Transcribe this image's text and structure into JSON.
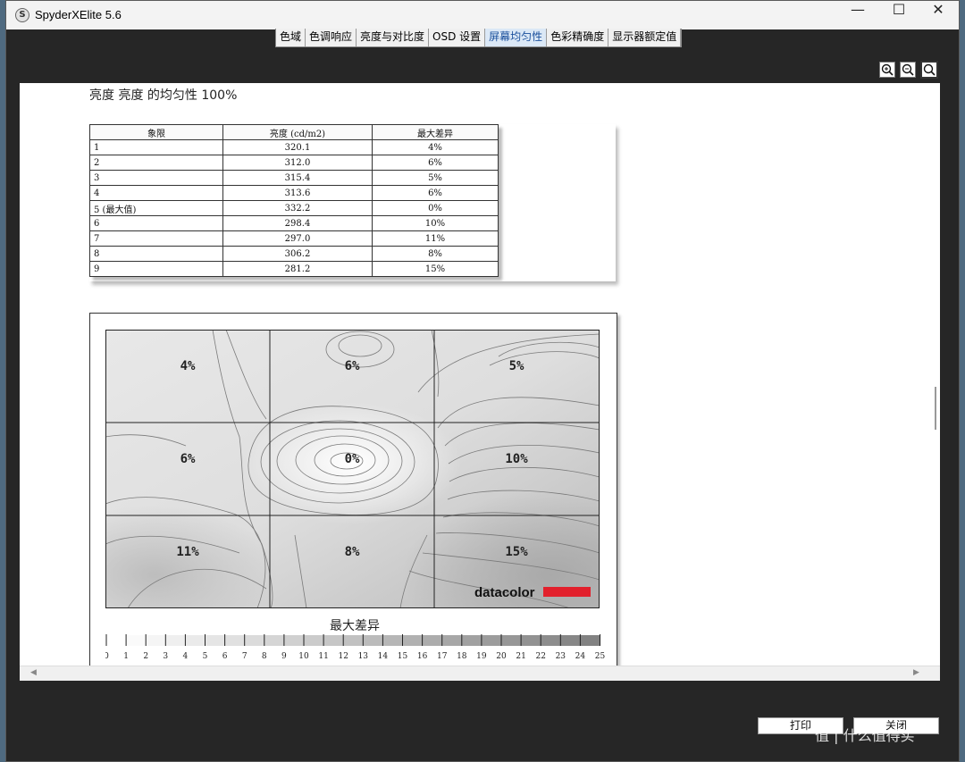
{
  "window": {
    "title": "SpyderXElite 5.6",
    "icon_letter": "S"
  },
  "titlebar_buttons": [
    "—",
    "☐",
    "✕"
  ],
  "tabs": [
    {
      "label": "色域",
      "active": false
    },
    {
      "label": "色调响应",
      "active": false
    },
    {
      "label": "亮度与对比度",
      "active": false
    },
    {
      "label": "OSD 设置",
      "active": false
    },
    {
      "label": "屏幕均匀性",
      "active": true
    },
    {
      "label": "色彩精确度",
      "active": false
    },
    {
      "label": "显示器额定值",
      "active": false
    }
  ],
  "zoom_icons": [
    "zoom-in-icon",
    "zoom-out-icon",
    "zoom-fit-icon"
  ],
  "report": {
    "heading": "亮度 亮度 的均匀性 100%",
    "table": {
      "headers": [
        "象限",
        "亮度 (cd/m2)",
        "最大差异"
      ],
      "rows": [
        [
          "1",
          "320.1",
          "4%"
        ],
        [
          "2",
          "312.0",
          "6%"
        ],
        [
          "3",
          "315.4",
          "5%"
        ],
        [
          "4",
          "313.6",
          "6%"
        ],
        [
          "5 (最大值)",
          "332.2",
          "0%"
        ],
        [
          "6",
          "298.4",
          "10%"
        ],
        [
          "7",
          "297.0",
          "11%"
        ],
        [
          "8",
          "306.2",
          "8%"
        ],
        [
          "9",
          "281.2",
          "15%"
        ]
      ]
    },
    "map": {
      "cells": [
        "4%",
        "6%",
        "5%",
        "6%",
        "0%",
        "10%",
        "11%",
        "8%",
        "15%"
      ],
      "brand": "datacolor",
      "brand_color": "#e2202c"
    },
    "scale": {
      "title": "最大差异",
      "ticks": [
        "0",
        "1",
        "2",
        "3",
        "4",
        "5",
        "6",
        "7",
        "8",
        "9",
        "10",
        "11",
        "12",
        "13",
        "14",
        "15",
        "16",
        "17",
        "18",
        "19",
        "20",
        "21",
        "22",
        "23",
        "24",
        "25"
      ]
    }
  },
  "buttons": {
    "print": "打印",
    "close": "关闭"
  },
  "watermark": "值 | 什么值得买"
}
